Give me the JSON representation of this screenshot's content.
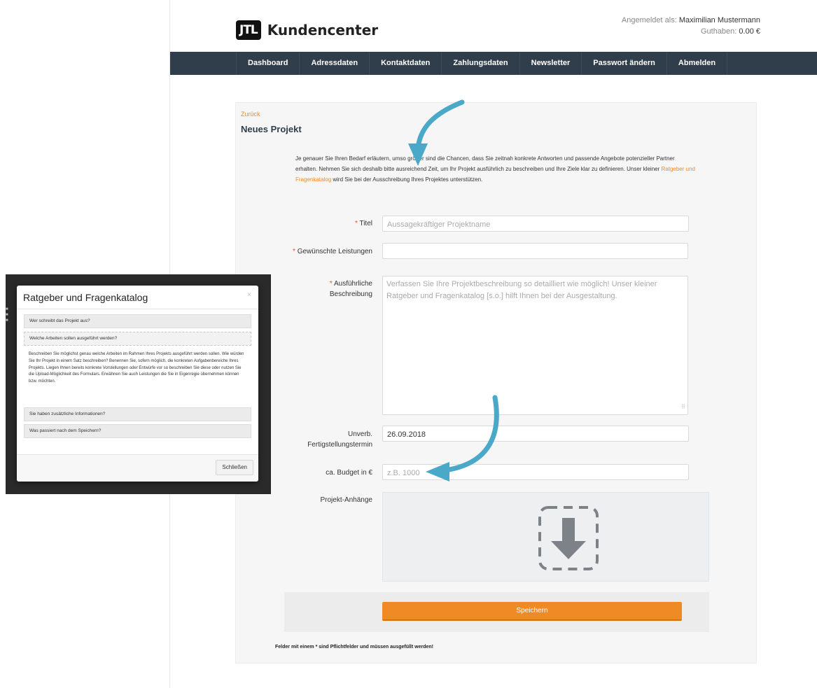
{
  "header": {
    "logo_mark": "JTL",
    "logo_text": "Kundencenter",
    "logged_in_label": "Angemeldet als:",
    "user_name": "Maximilian Mustermann",
    "balance_label": "Guthaben:",
    "balance_value": "0.00 €"
  },
  "nav": {
    "items": [
      "Dashboard",
      "Adressdaten",
      "Kontaktdaten",
      "Zahlungsdaten",
      "Newsletter",
      "Passwort ändern",
      "Abmelden"
    ]
  },
  "main": {
    "back_link": "Zurück",
    "title": "Neues Projekt",
    "intro_part1": "Je genauer Sie Ihren Bedarf erläutern, umso größer sind die Chancen, dass Sie zeitnah konkrete Antworten und passende Angebote potenzieller Partner erhalten. Nehmen Sie sich deshalb bitte ausreichend Zeit, um Ihr Projekt ausführlich zu beschreiben und Ihre Ziele klar zu definieren. Unser kleiner ",
    "intro_link": "Ratgeber und Fragenkatalog",
    "intro_part2": " wird Sie bei der Ausschreibung Ihres Projektes unterstützen."
  },
  "form": {
    "required_mark": "*",
    "title_label": "Titel",
    "title_placeholder": "Aussagekräftiger Projektname",
    "services_label": "Gewünschte Leistungen",
    "services_value": "",
    "description_label_1": "Ausführliche",
    "description_label_2": "Beschreibung",
    "description_placeholder": "Verfassen Sie Ihre Projektbeschreibung so detailliert wie möglich! Unser kleiner Ratgeber und Fragenkatalog [s.o.] hilft Ihnen bei der Ausgestaltung.",
    "deadline_label_1": "Unverb.",
    "deadline_label_2": "Fertigstellungstermin",
    "deadline_value": "26.09.2018",
    "budget_label": "ca. Budget in €",
    "budget_placeholder": "z.B. 1000",
    "attachments_label": "Projekt-Anhänge",
    "save_button": "Speichern",
    "footnote": "Felder mit einem * sind Pflichtfelder und müssen ausgefüllt werden!"
  },
  "modal": {
    "title": "Ratgeber und Fragenkatalog",
    "close_x": "×",
    "sections": [
      "Wer schreibt das Projekt aus?",
      "Welche Arbeiten sollen ausgeführt werden?",
      "Sie haben zusätzliche Informationen?",
      "Was passiert nach dem Speichern?"
    ],
    "active_body": "Beschreiben Sie möglichst genau welche Arbeiten im Rahmen Ihres Projekts ausgeführt werden sollen. Wie würden Sie Ihr Projekt in einem Satz beschreiben? Benennen Sie, sofern möglich, die konkreten Aufgabenbereiche Ihres Projekts. Liegen Ihnen bereits konkrete Vorstellungen oder Entwürfe vor so beschreiben Sie diese oder nutzen Sie die Upload-Möglichkeit des Formulars. Erwähnen Sie auch Leistungen die Sie in Eigenregie übernehmen können bzw. möchten.",
    "close_button": "Schließen"
  },
  "colors": {
    "nav_bg": "#2f3e4a",
    "accent_orange": "#f08a24",
    "annotation_arrow": "#4aa8c8"
  }
}
